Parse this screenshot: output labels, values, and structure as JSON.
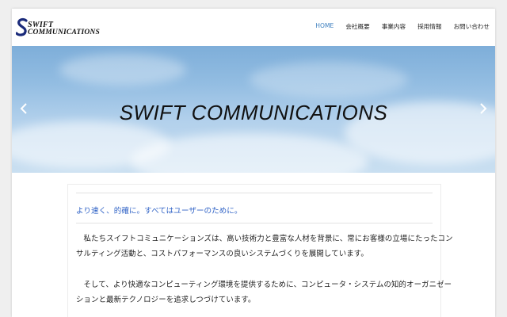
{
  "logo": {
    "line1": "SWIFT",
    "line2": "COMMUNICATIONS"
  },
  "nav": [
    {
      "label": "HOME",
      "active": true
    },
    {
      "label": "会社概要",
      "active": false
    },
    {
      "label": "事業内容",
      "active": false
    },
    {
      "label": "採用情報",
      "active": false
    },
    {
      "label": "お問い合わせ",
      "active": false
    }
  ],
  "hero": {
    "title": "SWIFT  COMMUNICATIONS"
  },
  "content": {
    "tagline": "より速く、的確に。すべてはユーザーのために。",
    "para1": [
      "　私たちスイフトコミュニケーションズは、高い技術力と豊富な人材を背景に、常にお客様の立場にたったコン",
      "サルティング活動と、コストパフォーマンスの良いシステムづくりを展開しています。"
    ],
    "para2": [
      "　そして、より快適なコンピューティング環境を提供するために、コンピュータ・システムの知的オーガニゼー",
      "ションと最新テクノロジーを追求しつづけています。"
    ]
  },
  "colors": {
    "accent": "#3c7fbf",
    "tagline": "#2f62c6"
  }
}
